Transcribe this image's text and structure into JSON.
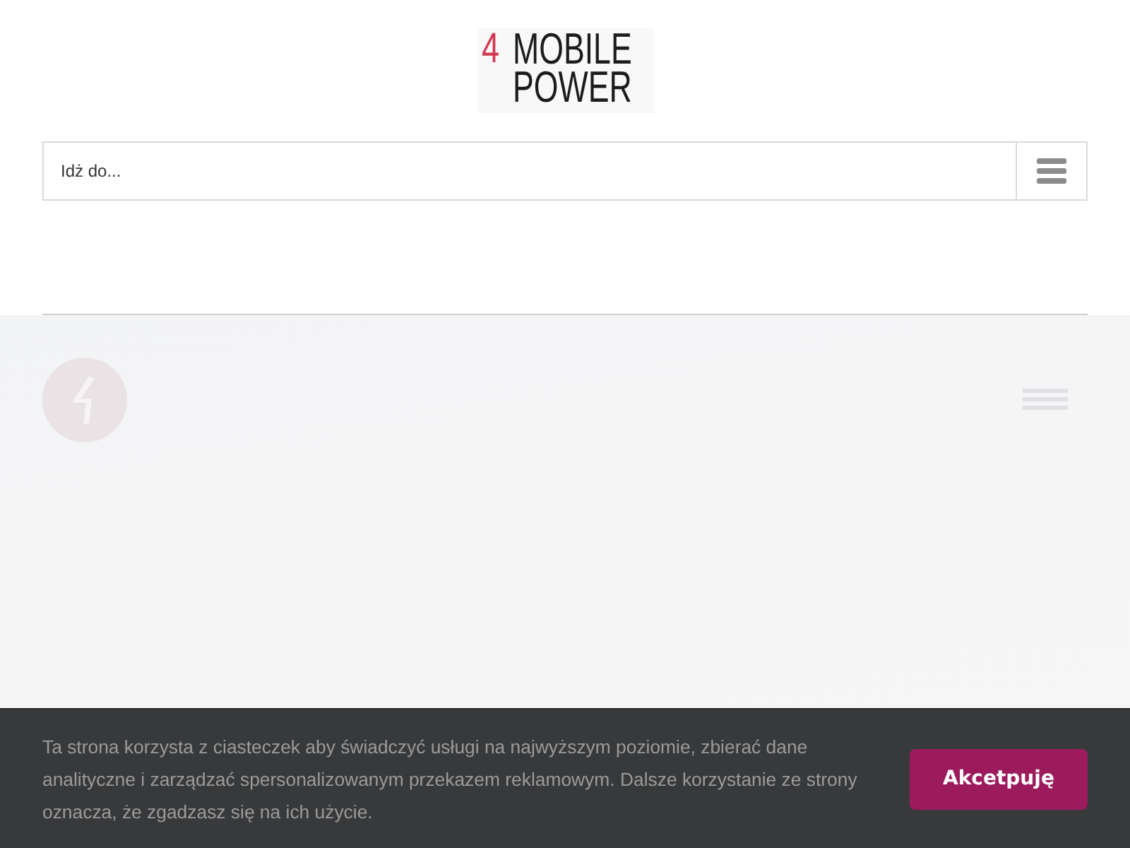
{
  "header": {
    "logo": {
      "mark": "4",
      "lines": [
        "MOBILE",
        "POWER"
      ]
    }
  },
  "navigation": {
    "select_label": "Idż do..."
  },
  "cookie_notice": {
    "text": "Ta strona korzysta z ciasteczek aby świadczyć usługi na najwyższym poziomie, zbierać dane analityczne i zarządzać spersonalizowanym przekazem reklamowym. Dalsze korzystanie ze strony oznacza, że zgadzasz się na ich użycie.",
    "button": "Akcetpuję"
  }
}
